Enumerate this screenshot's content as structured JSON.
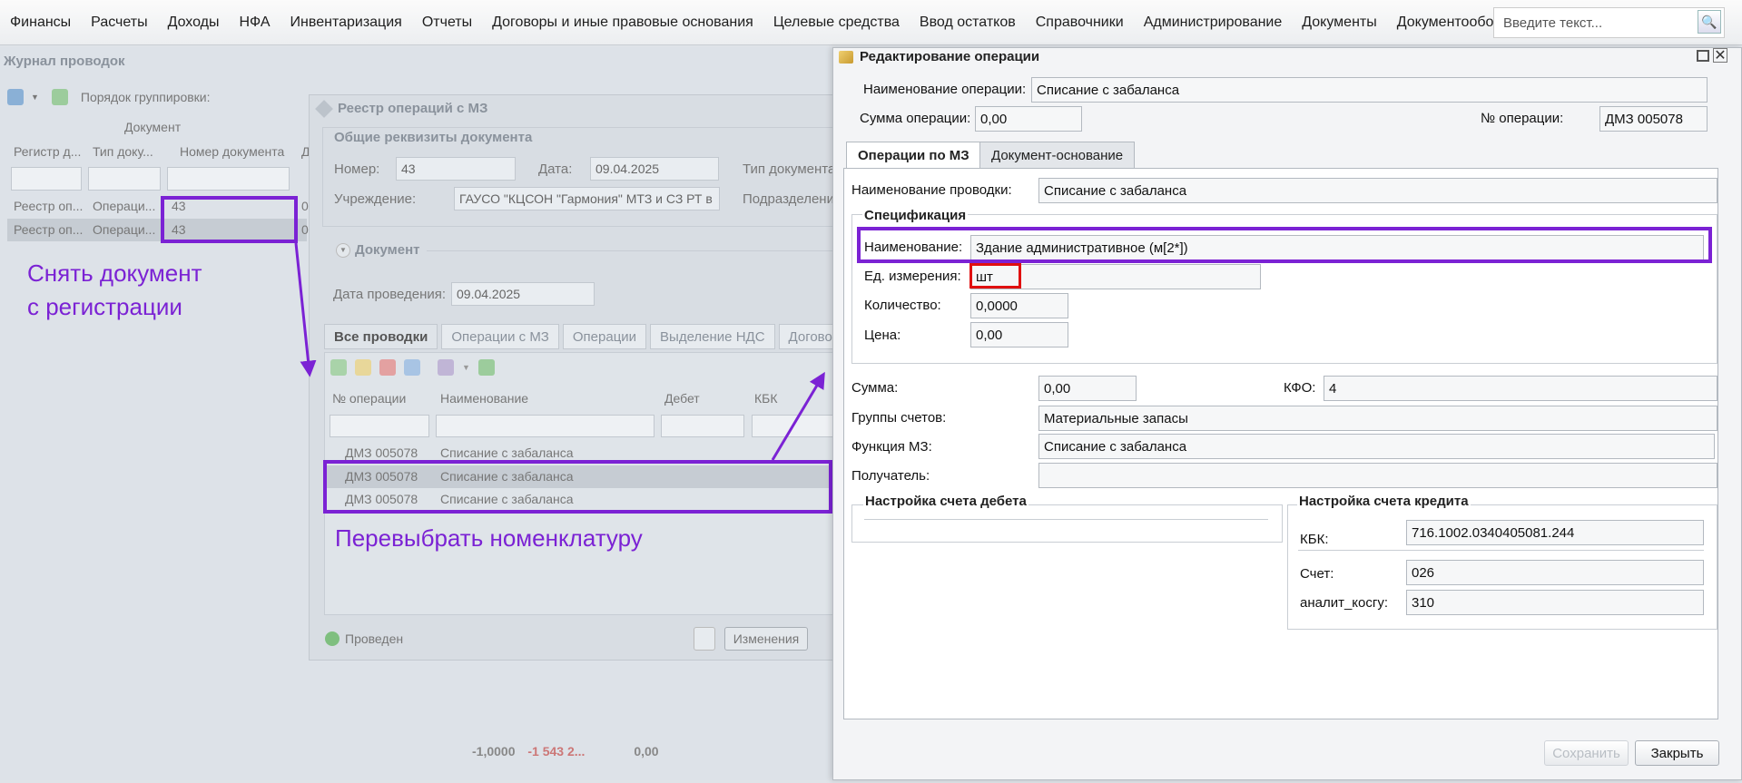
{
  "menu": {
    "items": [
      "Финансы",
      "Расчеты",
      "Доходы",
      "НФА",
      "Инвентаризация",
      "Отчеты",
      "Договоры и иные правовые основания",
      "Целевые средства",
      "Ввод остатков",
      "Справочники",
      "Администрирование",
      "Документы",
      "Документооборот"
    ],
    "alert_symbol": "!",
    "search_placeholder": "Введите текст...",
    "search_symbol": "🔍"
  },
  "journal": {
    "title": "Журнал проводок",
    "toolbar_group_label": "Порядок группировки:",
    "group_header": "Документ",
    "columns": [
      "Регистр д...",
      "Тип доку...",
      "Номер документа",
      "Д"
    ],
    "rows": [
      {
        "registry": "Реестр оп...",
        "type": "Операци...",
        "number": "43",
        "d": "0"
      },
      {
        "registry": "Реестр оп...",
        "type": "Операци...",
        "number": "43",
        "d": "0"
      }
    ],
    "totals": {
      "a": "-1,0000",
      "b": "-1 543 2...",
      "c": "0,00"
    }
  },
  "registry": {
    "title": "Реестр операций с МЗ",
    "section_general": "Общие реквизиты документа",
    "number_label": "Номер:",
    "number_value": "43",
    "date_label": "Дата:",
    "date_value": "09.04.2025",
    "doctype_label": "Тип документа",
    "institution_label": "Учреждение:",
    "institution_value": "ГАУСО \"КЦСОН \"Гармония\" МТЗ и СЗ РТ в",
    "subdivision_label": "Подразделени",
    "section_document": "Документ",
    "posting_date_label": "Дата проведения:",
    "posting_date_value": "09.04.2025",
    "tabs": [
      "Все проводки",
      "Операции с МЗ",
      "Операции",
      "Выделение НДС",
      "Договор"
    ],
    "columns": [
      "№ операции",
      "Наименование",
      "Дебет",
      "КБК"
    ],
    "rows": [
      {
        "op": "ДМЗ 005078",
        "name": "Списание с забаланса"
      },
      {
        "op": "ДМЗ 005078",
        "name": "Списание с забаланса"
      },
      {
        "op": "ДМЗ 005078",
        "name": "Списание с забаланса"
      }
    ],
    "status": "Проведен",
    "changes_button": "Изменения"
  },
  "annotations": {
    "unregister": [
      "Снять документ",
      "с регистрации"
    ],
    "reselect": "Перевыбрать номенклатуру"
  },
  "edit": {
    "title": "Редактирование операции",
    "op_name_label": "Наименование операции:",
    "op_name_value": "Списание с забаланса",
    "op_sum_label": "Сумма операции:",
    "op_sum_value": "0,00",
    "op_number_label": "№ операции:",
    "op_number_value": "ДМЗ 005078",
    "tabs": [
      "Операции по МЗ",
      "Документ-основание"
    ],
    "posting_name_label": "Наименование проводки:",
    "posting_name_value": "Списание с забаланса",
    "spec_title": "Спецификация",
    "item_name_label": "Наименование:",
    "item_name_value": "Здание административное (м[2*])",
    "unit_label": "Ед. измерения:",
    "unit_value": "шт",
    "qty_label": "Количество:",
    "qty_value": "0,0000",
    "price_label": "Цена:",
    "price_value": "0,00",
    "sum_label": "Сумма:",
    "sum_value": "0,00",
    "kfo_label": "КФО:",
    "kfo_value": "4",
    "groups_label": "Группы счетов:",
    "groups_value": "Материальные запасы",
    "function_label": "Функция МЗ:",
    "function_value": "Списание с забаланса",
    "recipient_label": "Получатель:",
    "recipient_value": "",
    "debit_title": "Настройка счета дебета",
    "credit_title": "Настройка счета кредита",
    "kbk_label": "КБК:",
    "kbk_value": "716.1002.0340405081.244",
    "account_label": "Счет:",
    "account_value": "026",
    "kosgu_label": "аналит_косгу:",
    "kosgu_value": "310",
    "save_button": "Сохранить",
    "close_button": "Закрыть"
  },
  "colors": {
    "annotation": "#7b22d4",
    "highlight_red": "#e01010"
  }
}
